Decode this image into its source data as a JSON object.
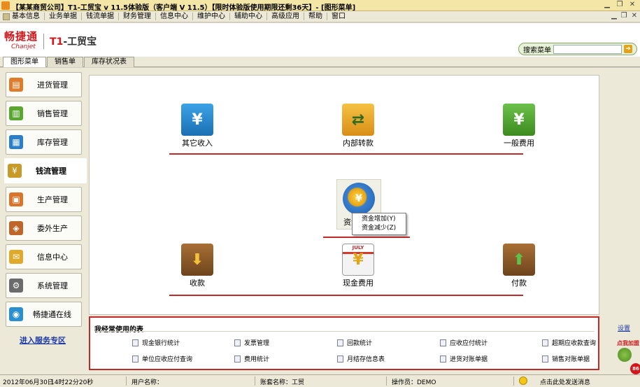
{
  "window": {
    "title": "【某某商贸公司】T1-工贸宝 v 11.5体验版（客户端 V 11.5）【限时体验版使用期限还剩36天】- [图形菜单]"
  },
  "menubar": {
    "items": [
      "基本信息",
      "业务单据",
      "钱流单据",
      "财务管理",
      "信息中心",
      "维护中心",
      "辅助中心",
      "高级应用",
      "帮助",
      "窗口"
    ]
  },
  "header": {
    "brand": "畅捷通",
    "brand_sub": "Chanjet",
    "product_prefix": "T1",
    "product_suffix": "-工贸宝",
    "search_label": "搜索菜单",
    "search_value": ""
  },
  "tabs": [
    "图形菜单",
    "销售单",
    "库存状况表"
  ],
  "sidebar": {
    "items": [
      {
        "label": "进货管理",
        "icon": "purchase-icon",
        "color": "#e07b2a"
      },
      {
        "label": "销售管理",
        "icon": "basket-icon",
        "color": "#5aa631"
      },
      {
        "label": "库存管理",
        "icon": "warehouse-icon",
        "color": "#2a7fc8"
      },
      {
        "label": "钱流管理",
        "icon": "money-bag-icon",
        "color": "#c89a2a"
      },
      {
        "label": "生产管理",
        "icon": "production-icon",
        "color": "#d9742a"
      },
      {
        "label": "委外生产",
        "icon": "outsource-icon",
        "color": "#c0652a"
      },
      {
        "label": "信息中心",
        "icon": "mail-icon",
        "color": "#e0a92a"
      },
      {
        "label": "系统管理",
        "icon": "settings-icon",
        "color": "#6b6b6b"
      },
      {
        "label": "畅捷通在线",
        "icon": "globe-icon",
        "color": "#2a8fd0"
      }
    ],
    "active_index": 3,
    "service_link": "进入服务专区"
  },
  "canvas": {
    "functions": [
      {
        "label": "其它收入",
        "icon": "yuan-receipt-icon",
        "color": "#2d8fd0"
      },
      {
        "label": "内部转款",
        "icon": "transfer-icon",
        "color": "#e7a825"
      },
      {
        "label": "一般费用",
        "icon": "yuan-expense-icon",
        "color": "#4ea52b"
      },
      {
        "label": "收款",
        "icon": "receive-chest-icon",
        "color": "#8a5a2b"
      },
      {
        "label": "现金费用",
        "icon": "calendar-cash-icon",
        "color": "#c83226"
      },
      {
        "label": "付款",
        "icon": "pay-chest-icon",
        "color": "#8a5a2b"
      }
    ],
    "center_function": {
      "label": "资金",
      "icon": "fund-icon"
    },
    "context_menu": [
      "资金增加(Y)",
      "资金减少(Z)"
    ],
    "calendar_text": "JULY"
  },
  "frequent": {
    "title": "我经常使用的表",
    "items": [
      "现金银行统计",
      "发票管理",
      "回款统计",
      "应收应付统计",
      "超期应收款查询",
      "单位应收应付查询",
      "费用统计",
      "月结存信息表",
      "进货对账单据",
      "销售对账单据"
    ],
    "settings_link": "设置",
    "float_ad_text": "点我加盟",
    "float_badge": "86"
  },
  "statusbar": {
    "date": "2012年06月30日",
    "time": "14时22分20秒",
    "user_label": "用户名称：",
    "account_label": "账套名称：工贸",
    "operator_label": "操作员：DEMO",
    "message_text": "点击此处发送消息"
  }
}
